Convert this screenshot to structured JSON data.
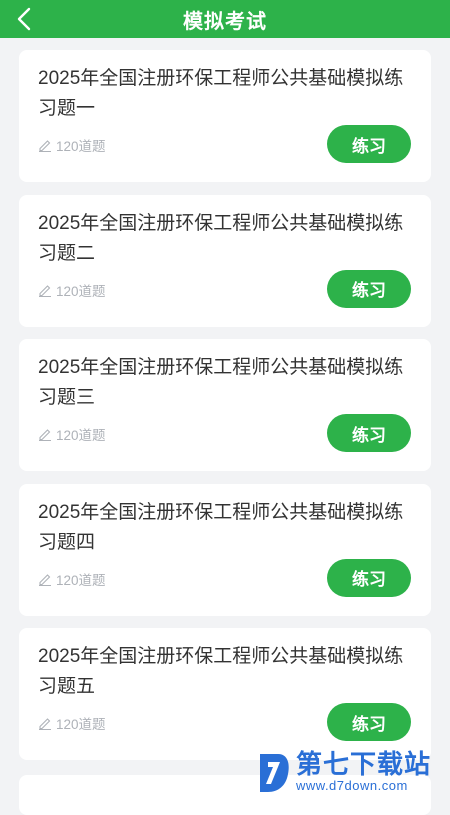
{
  "header": {
    "title": "模拟考试",
    "back_icon": "chevron-left-icon"
  },
  "exams": [
    {
      "title": "2025年全国注册环保工程师公共基础模拟练习题一",
      "count": "120道题",
      "button": "练习"
    },
    {
      "title": "2025年全国注册环保工程师公共基础模拟练习题二",
      "count": "120道题",
      "button": "练习"
    },
    {
      "title": "2025年全国注册环保工程师公共基础模拟练习题三",
      "count": "120道题",
      "button": "练习"
    },
    {
      "title": "2025年全国注册环保工程师公共基础模拟练习题四",
      "count": "120道题",
      "button": "练习"
    },
    {
      "title": "2025年全国注册环保工程师公共基础模拟练习题五",
      "count": "120道题",
      "button": "练习"
    }
  ],
  "watermark": {
    "name": "第七下载站",
    "url": "www.d7down.com"
  },
  "colors": {
    "accent": "#2db24a",
    "background": "#f2f3f5",
    "watermark": "#2a6fd6"
  }
}
